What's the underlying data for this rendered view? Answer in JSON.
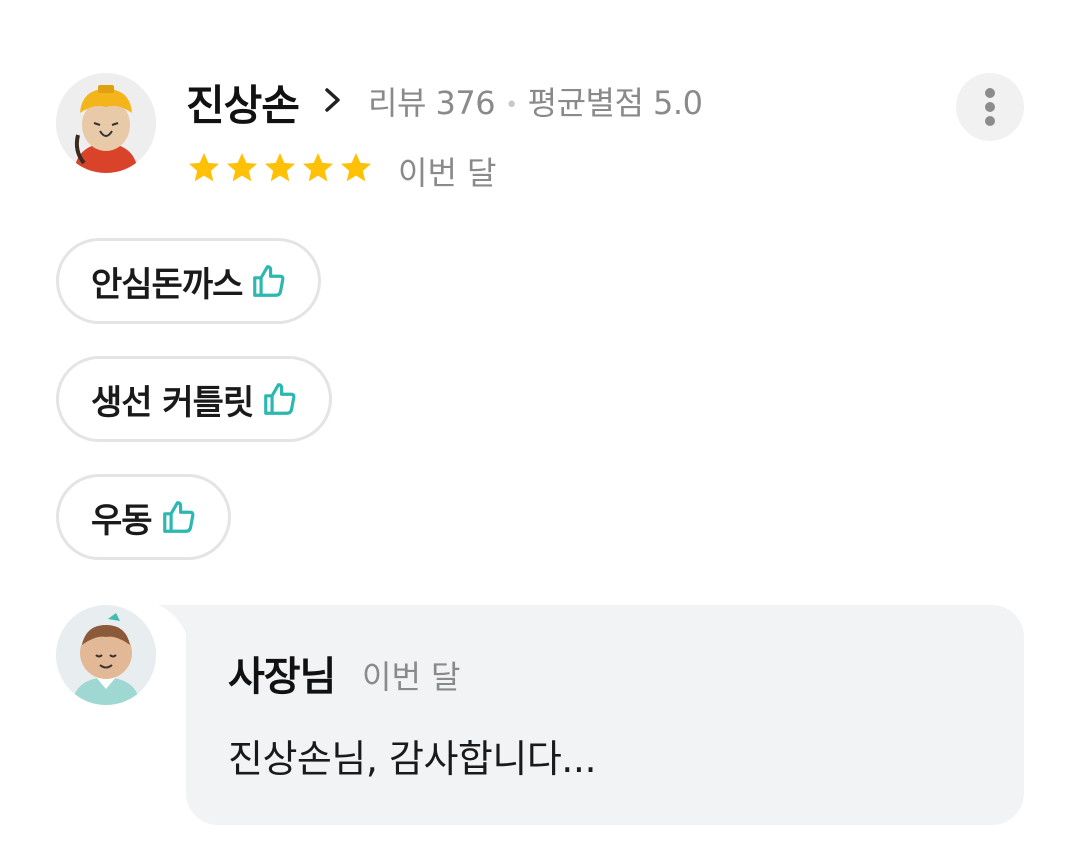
{
  "review": {
    "user_name": "진상손",
    "review_count_label": "리뷰 376",
    "separator": "•",
    "avg_rating_label": "평균별점 5.0",
    "rating": 5,
    "date": "이번 달",
    "star_color": "#ffc107",
    "avatar_icon": "user-avatar-illustration",
    "menu_icon": "more-vertical-icon"
  },
  "liked_menus": [
    {
      "label": "안심돈까스",
      "icon": "thumbs-up-icon"
    },
    {
      "label": "생선 커틀릿",
      "icon": "thumbs-up-icon"
    },
    {
      "label": "우동",
      "icon": "thumbs-up-icon"
    }
  ],
  "owner_reply": {
    "author": "사장님",
    "date": "이번 달",
    "text": "진상손님, 감사합니다...",
    "avatar_icon": "owner-avatar-illustration"
  },
  "colors": {
    "thumb_accent": "#2bb8b0",
    "bubble_bg": "#f2f3f5",
    "muted_text": "#8a8a8a"
  }
}
